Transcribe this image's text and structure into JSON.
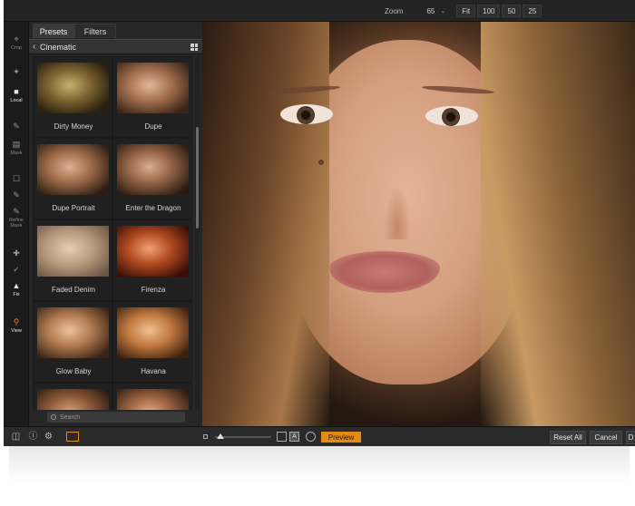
{
  "topbar": {
    "zoom_label": "Zoom",
    "zoom_value": "65",
    "zoom_options": [
      "Fit",
      "100",
      "50",
      "25"
    ]
  },
  "tools": [
    {
      "id": "crop",
      "label": "Crop",
      "icon": "crop-icon"
    },
    {
      "id": "local",
      "label": "Local",
      "icon": "local-adjust-icon"
    },
    {
      "id": "mask",
      "label": "Mask",
      "icon": "mask-icon"
    },
    {
      "id": "refine",
      "label": "Refine Mask",
      "icon": "refine-brush-icon"
    },
    {
      "id": "fix",
      "label": "Fix",
      "icon": "stamp-icon"
    },
    {
      "id": "view",
      "label": "View",
      "icon": "magnifier-icon"
    }
  ],
  "panel": {
    "tabs": [
      "Presets",
      "Filters"
    ],
    "active_tab": "Presets",
    "category": "Cinematic",
    "presets": [
      "Dirty Money",
      "Dupe",
      "Dupe Portrait",
      "Enter the Dragon",
      "Faded Denim",
      "Firenza",
      "Glow Baby",
      "Havana"
    ],
    "search_placeholder": "Search"
  },
  "bottombar": {
    "preview_label": "Preview",
    "compare_label": "A",
    "reset_label": "Reset All",
    "cancel_label": "Cancel",
    "done_label": "D"
  },
  "colors": {
    "accent": "#e58a16",
    "panel_bg": "#262626",
    "window_bg": "#1f1f1f"
  }
}
